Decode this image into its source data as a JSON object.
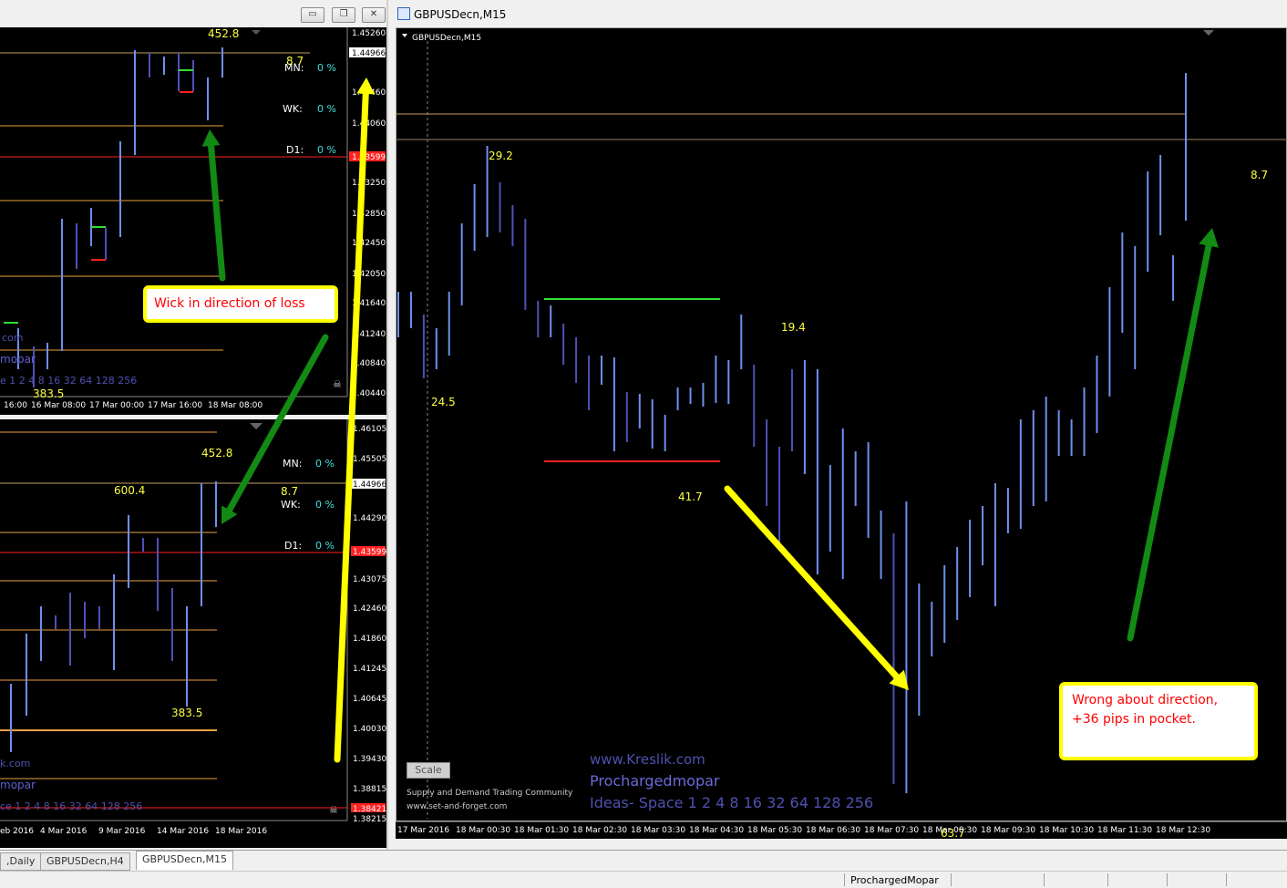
{
  "window_controls": {
    "minimize": "▭",
    "restore": "❐",
    "close": "✕"
  },
  "main_window": {
    "title": "GBPUSDecn,M15",
    "chart_label": "GBPUSDecn,M15",
    "labels": {
      "l292": "29.2",
      "l245": "24.5",
      "l194": "19.4",
      "l417": "41.7",
      "l637": "63.7",
      "l87": "8.7"
    },
    "time_axis": [
      "17 Mar 2016",
      "18 Mar 00:30",
      "18 Mar 01:30",
      "18 Mar 02:30",
      "18 Mar 03:30",
      "18 Mar 04:30",
      "18 Mar 05:30",
      "18 Mar 06:30",
      "18 Mar 07:30",
      "18 Mar 08:30",
      "18 Mar 09:30",
      "18 Mar 10:30",
      "18 Mar 11:30",
      "18 Mar 12:30"
    ],
    "scale_button": "Scale",
    "footer_left_1": "Supply and Demand Trading Community",
    "footer_left_2": "www.set-and-forget.com",
    "watermark_1": "www.Kreslik.com",
    "watermark_2": "Prochargedmopar",
    "watermark_3": "Ideas- Space 1 2 4 8 16 32 64 128 256",
    "note": "Wrong about direction, +36 pips in pocket."
  },
  "top_left_window": {
    "labels": {
      "l4528": "452.8",
      "l87": "8.7",
      "l3835": "383.5"
    },
    "stats": {
      "mn": "MN:",
      "wk": "WK:",
      "d1": "D1:",
      "pct": "0 %"
    },
    "price_axis": [
      "1.45260",
      "1.44966",
      "1.44460",
      "1.44060",
      "1.43599",
      "1.43250",
      "1.42850",
      "1.42450",
      "1.42050",
      "1.41640",
      "1.41240",
      "1.40840",
      "1.40440"
    ],
    "time_axis": [
      "16:00",
      "16 Mar 08:00",
      "17 Mar 00:00",
      "17 Mar 16:00",
      "18 Mar 08:00"
    ],
    "watermark": [
      "com",
      "mopar",
      "e 1 2 4 8 16 32 64 128 256"
    ],
    "note": "Wick in direction of loss"
  },
  "bottom_left_window": {
    "labels": {
      "l4528": "452.8",
      "l6004": "600.4",
      "l87": "8.7",
      "l3835": "383.5"
    },
    "stats": {
      "mn": "MN:",
      "wk": "WK:",
      "d1": "D1:",
      "pct": "0 %"
    },
    "price_axis": [
      "1.46105",
      "1.45505",
      "1.44966",
      "1.44290",
      "1.43599",
      "1.43075",
      "1.42460",
      "1.41860",
      "1.41245",
      "1.40645",
      "1.40030",
      "1.39430",
      "1.38815",
      "1.38421",
      "1.38215"
    ],
    "time_axis": [
      "eb 2016",
      "4 Mar 2016",
      "9 Mar 2016",
      "14 Mar 2016",
      "18 Mar 2016"
    ],
    "watermark": [
      "k.com",
      "mopar",
      "ce 1 2 4 8 16 32 64 128 256"
    ]
  },
  "tabs": [
    ",Daily",
    "GBPUSDecn,H4",
    "GBPUSDecn,M15"
  ],
  "status": {
    "profile": "ProchargedMopar"
  },
  "colors": {
    "bull": "#6f8ff0",
    "bear": "#5050b8",
    "level_orange": "#e8a040",
    "level_red": "#ff2020",
    "level_green": "#30e030",
    "label_yellow": "#ffff40",
    "arrow_green": "#138a13",
    "arrow_yellow": "#ffff00",
    "pct_cyan": "#40e0e0"
  }
}
